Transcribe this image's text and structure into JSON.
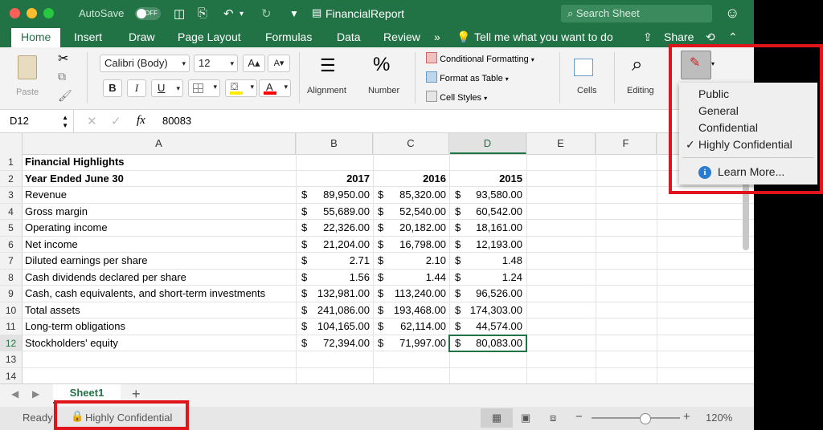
{
  "titlebar": {
    "autosave_label": "AutoSave",
    "autosave_state": "OFF",
    "document_title": "FinancialReport",
    "search_placeholder": "Search Sheet",
    "accent_color": "#217346"
  },
  "tabs": [
    "Home",
    "Insert",
    "Draw",
    "Page Layout",
    "Formulas",
    "Data",
    "Review"
  ],
  "tabs_more": "»",
  "tell_me": "Tell me what you want to do",
  "share_label": "Share",
  "ribbon": {
    "paste_label": "Paste",
    "font_name": "Calibri (Body)",
    "font_size": "12",
    "grow_font": "A▴",
    "shrink_font": "A▾",
    "bold": "B",
    "italic": "I",
    "underline": "U",
    "alignment_label": "Alignment",
    "number_label": "Number",
    "conditional_formatting": "Conditional Formatting",
    "format_as_table": "Format as Table",
    "cell_styles": "Cell Styles",
    "cells_label": "Cells",
    "editing_label": "Editing",
    "sensitivity_label": "S"
  },
  "formula_bar": {
    "name_box": "D12",
    "fx": "fx",
    "value": "80083"
  },
  "columns": [
    "A",
    "B",
    "C",
    "D",
    "E",
    "F"
  ],
  "rows": [
    {
      "n": "1",
      "label": "Financial Highlights",
      "bold": true,
      "b_cur": "",
      "b": "",
      "c_cur": "",
      "c": "",
      "d_cur": "",
      "d": ""
    },
    {
      "n": "2",
      "label": "Year Ended June 30",
      "bold": true,
      "b_cur": "",
      "b": "2017",
      "c_cur": "",
      "c": "2016",
      "d_cur": "",
      "d": "2015"
    },
    {
      "n": "3",
      "label": "Revenue",
      "b_cur": "$",
      "b": "89,950.00",
      "c_cur": "$",
      "c": "85,320.00",
      "d_cur": "$",
      "d": "93,580.00"
    },
    {
      "n": "4",
      "label": "Gross margin",
      "b_cur": "$",
      "b": "55,689.00",
      "c_cur": "$",
      "c": "52,540.00",
      "d_cur": "$",
      "d": "60,542.00"
    },
    {
      "n": "5",
      "label": "Operating income",
      "b_cur": "$",
      "b": "22,326.00",
      "c_cur": "$",
      "c": "20,182.00",
      "d_cur": "$",
      "d": "18,161.00"
    },
    {
      "n": "6",
      "label": "Net income",
      "b_cur": "$",
      "b": "21,204.00",
      "c_cur": "$",
      "c": "16,798.00",
      "d_cur": "$",
      "d": "12,193.00"
    },
    {
      "n": "7",
      "label": "Diluted earnings per share",
      "b_cur": "$",
      "b": "2.71",
      "c_cur": "$",
      "c": "2.10",
      "d_cur": "$",
      "d": "1.48"
    },
    {
      "n": "8",
      "label": "Cash dividends declared per share",
      "b_cur": "$",
      "b": "1.56",
      "c_cur": "$",
      "c": "1.44",
      "d_cur": "$",
      "d": "1.24"
    },
    {
      "n": "9",
      "label": "Cash, cash equivalents, and short-term investments",
      "b_cur": "$",
      "b": "132,981.00",
      "c_cur": "$",
      "c": "113,240.00",
      "d_cur": "$",
      "d": "96,526.00"
    },
    {
      "n": "10",
      "label": "Total assets",
      "b_cur": "$",
      "b": "241,086.00",
      "c_cur": "$",
      "c": "193,468.00",
      "d_cur": "$",
      "d": "174,303.00"
    },
    {
      "n": "11",
      "label": "Long-term obligations",
      "b_cur": "$",
      "b": "104,165.00",
      "c_cur": "$",
      "c": "62,114.00",
      "d_cur": "$",
      "d": "44,574.00"
    },
    {
      "n": "12",
      "label": "Stockholders' equity",
      "b_cur": "$",
      "b": "72,394.00",
      "c_cur": "$",
      "c": "71,997.00",
      "d_cur": "$",
      "d": "80,083.00"
    },
    {
      "n": "13",
      "label": "",
      "b_cur": "",
      "b": "",
      "c_cur": "",
      "c": "",
      "d_cur": "",
      "d": ""
    },
    {
      "n": "14",
      "label": "",
      "b_cur": "",
      "b": "",
      "c_cur": "",
      "c": "",
      "d_cur": "",
      "d": ""
    }
  ],
  "sheet_tab": "Sheet1",
  "add_sheet": "+",
  "status": {
    "ready": "Ready",
    "sensitivity": "Highly Confidential",
    "zoom": "120%",
    "zoom_fraction": 0.6
  },
  "sensitivity_menu": {
    "items": [
      "Public",
      "General",
      "Confidential",
      "Highly Confidential"
    ],
    "checked": "Highly Confidential",
    "check_mark": "✓",
    "learn_more": "Learn More..."
  },
  "highlight_color": "#e0151b"
}
